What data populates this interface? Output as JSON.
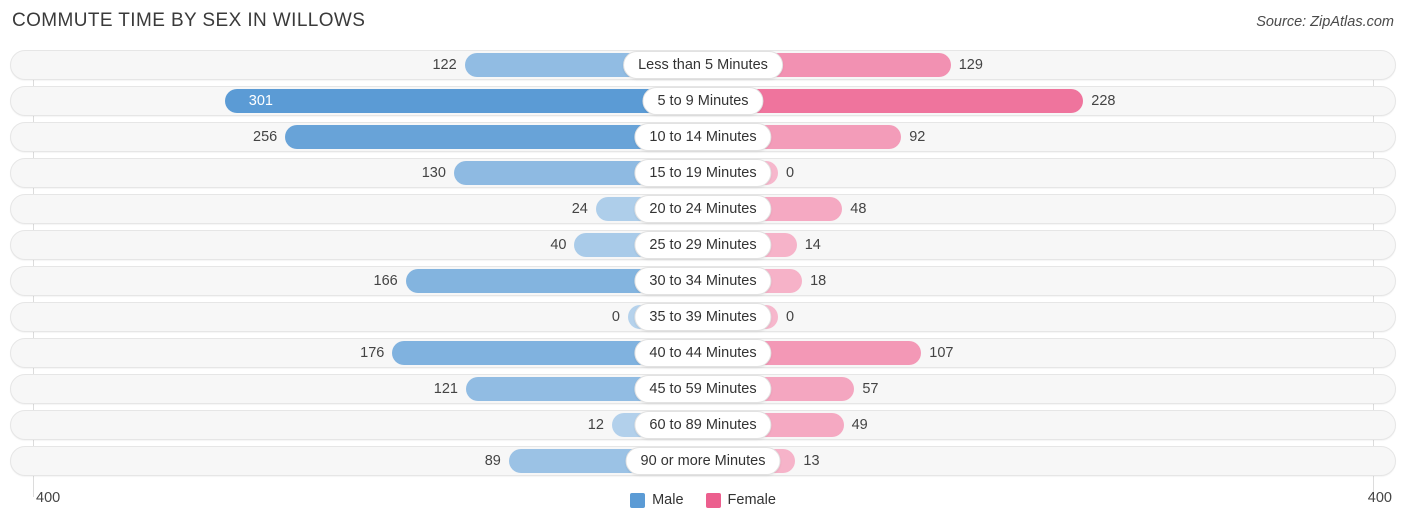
{
  "header": {
    "title": "COMMUTE TIME BY SEX IN WILLOWS",
    "source": "Source: ZipAtlas.com"
  },
  "axis": {
    "left_max": "400",
    "right_max": "400"
  },
  "legend": {
    "items": [
      {
        "label": "Male",
        "color": "#5b9bd5",
        "name": "legend-male"
      },
      {
        "label": "Female",
        "color": "#ec5f8e",
        "name": "legend-female"
      }
    ]
  },
  "colors": {
    "male": "#5b9bd5",
    "female": "#ec5f8e",
    "track": "#f7f7f7",
    "track_border": "#e6e6e6",
    "axis_line": "#dcdcdc",
    "pill_bg": "#ffffff",
    "pill_border": "#e2e2e2"
  },
  "chart_data": {
    "type": "bar",
    "title": "COMMUTE TIME BY SEX IN WILLOWS",
    "subtitle": "",
    "orientation": "horizontal-diverging",
    "xlabel": "",
    "ylabel": "",
    "xlim": [
      0,
      400
    ],
    "grid": false,
    "legend_position": "bottom-center",
    "categories": [
      "Less than 5 Minutes",
      "5 to 9 Minutes",
      "10 to 14 Minutes",
      "15 to 19 Minutes",
      "20 to 24 Minutes",
      "25 to 29 Minutes",
      "30 to 34 Minutes",
      "35 to 39 Minutes",
      "40 to 44 Minutes",
      "45 to 59 Minutes",
      "60 to 89 Minutes",
      "90 or more Minutes"
    ],
    "series": [
      {
        "name": "Male",
        "color": "#5b9bd5",
        "values": [
          122,
          301,
          256,
          130,
          24,
          40,
          166,
          0,
          176,
          121,
          12,
          89
        ]
      },
      {
        "name": "Female",
        "color": "#ec5f8e",
        "values": [
          129,
          228,
          92,
          0,
          48,
          14,
          18,
          0,
          107,
          57,
          49,
          13
        ]
      }
    ]
  },
  "rows": [
    {
      "label": "Less than 5 Minutes",
      "male": "122",
      "female": "129",
      "male_v": 122,
      "female_v": 129
    },
    {
      "label": "5 to 9 Minutes",
      "male": "301",
      "female": "228",
      "male_v": 301,
      "female_v": 228
    },
    {
      "label": "10 to 14 Minutes",
      "male": "256",
      "female": "92",
      "male_v": 256,
      "female_v": 92
    },
    {
      "label": "15 to 19 Minutes",
      "male": "130",
      "female": "0",
      "male_v": 130,
      "female_v": 0
    },
    {
      "label": "20 to 24 Minutes",
      "male": "24",
      "female": "48",
      "male_v": 24,
      "female_v": 48
    },
    {
      "label": "25 to 29 Minutes",
      "male": "40",
      "female": "14",
      "male_v": 40,
      "female_v": 14
    },
    {
      "label": "30 to 34 Minutes",
      "male": "166",
      "female": "18",
      "male_v": 166,
      "female_v": 18
    },
    {
      "label": "35 to 39 Minutes",
      "male": "0",
      "female": "0",
      "male_v": 0,
      "female_v": 0
    },
    {
      "label": "40 to 44 Minutes",
      "male": "176",
      "female": "107",
      "male_v": 176,
      "female_v": 107
    },
    {
      "label": "45 to 59 Minutes",
      "male": "121",
      "female": "57",
      "male_v": 121,
      "female_v": 57
    },
    {
      "label": "60 to 89 Minutes",
      "male": "12",
      "female": "49",
      "male_v": 12,
      "female_v": 49
    },
    {
      "label": "90 or more Minutes",
      "male": "89",
      "female": "13",
      "male_v": 89,
      "female_v": 13
    }
  ]
}
